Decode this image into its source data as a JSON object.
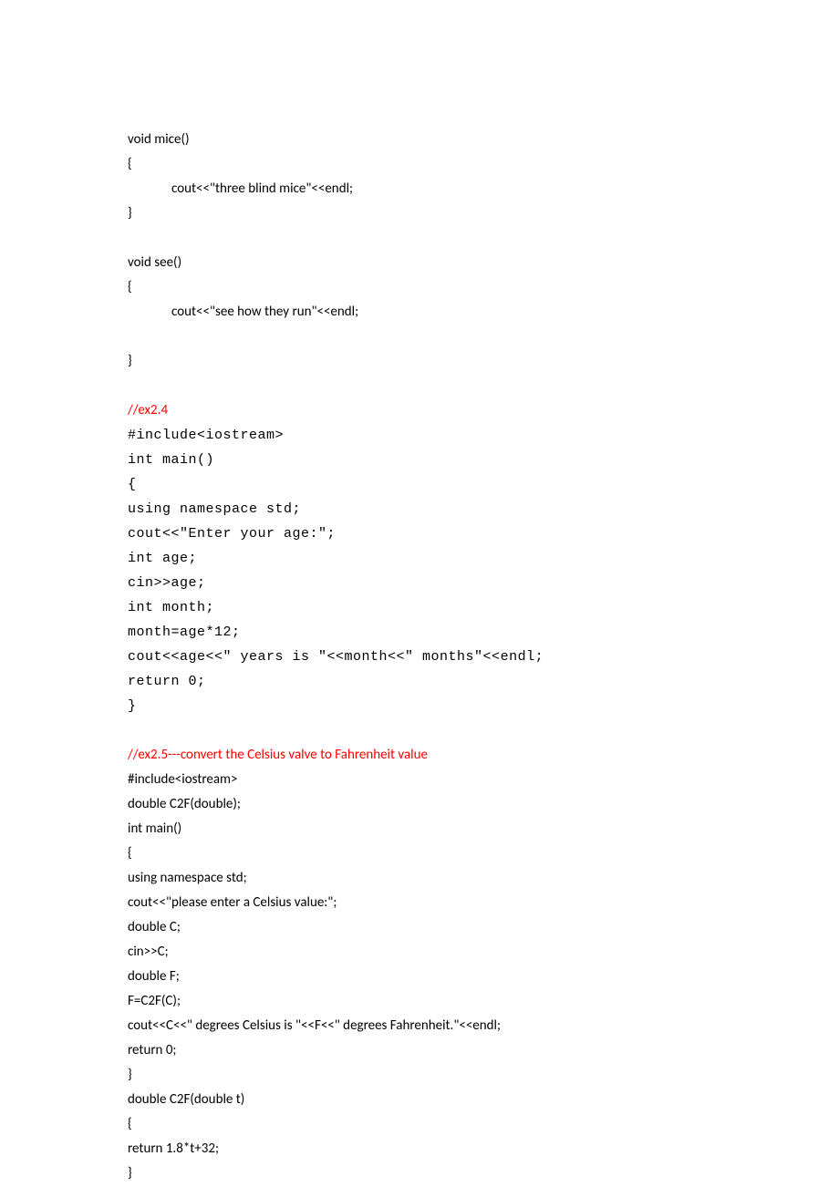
{
  "block1": {
    "l1": "void mice()",
    "l2": "{",
    "l3": "cout<<\"three blind mice\"<<endl;",
    "l4": "}"
  },
  "block2": {
    "l1": "void see()",
    "l2": "{",
    "l3": "cout<<\"see how they run\"<<endl;",
    "l4": "}"
  },
  "ex24": {
    "comment": "//ex2.4",
    "l1": "#include<iostream>",
    "l2": "int main()",
    "l3": "{",
    "l4": " using namespace std;",
    "l5": " cout<<\"Enter your age:\";",
    "l6": " int age;",
    "l7": " cin>>age;",
    "l8": " int month;",
    "l9": " month=age*12;",
    "l10": " cout<<age<<\" years is \"<<month<<\" months\"<<endl;",
    "l11": " return 0;",
    "l12": "}"
  },
  "ex25": {
    "comment": "//ex2.5---convert the Celsius valve to Fahrenheit value",
    "l1": "#include<iostream>",
    "l2": "double C2F(double);",
    "l3": "int main()",
    "l4": "{",
    "l5": "using namespace std;",
    "l6": "cout<<\"please enter a Celsius value:\";",
    "l7": "double C;",
    "l8": "cin>>C;",
    "l9": "double F;",
    "l10": "F=C2F(C);",
    "l11": "cout<<C<<\" degrees Celsius is \"<<F<<\" degrees Fahrenheit.\"<<endl;",
    "l12": "return 0;",
    "l13": "}",
    "l14": "double C2F(double t)",
    "l15": "{",
    "l16": "return 1.8*t+32;",
    "l17": "}"
  }
}
